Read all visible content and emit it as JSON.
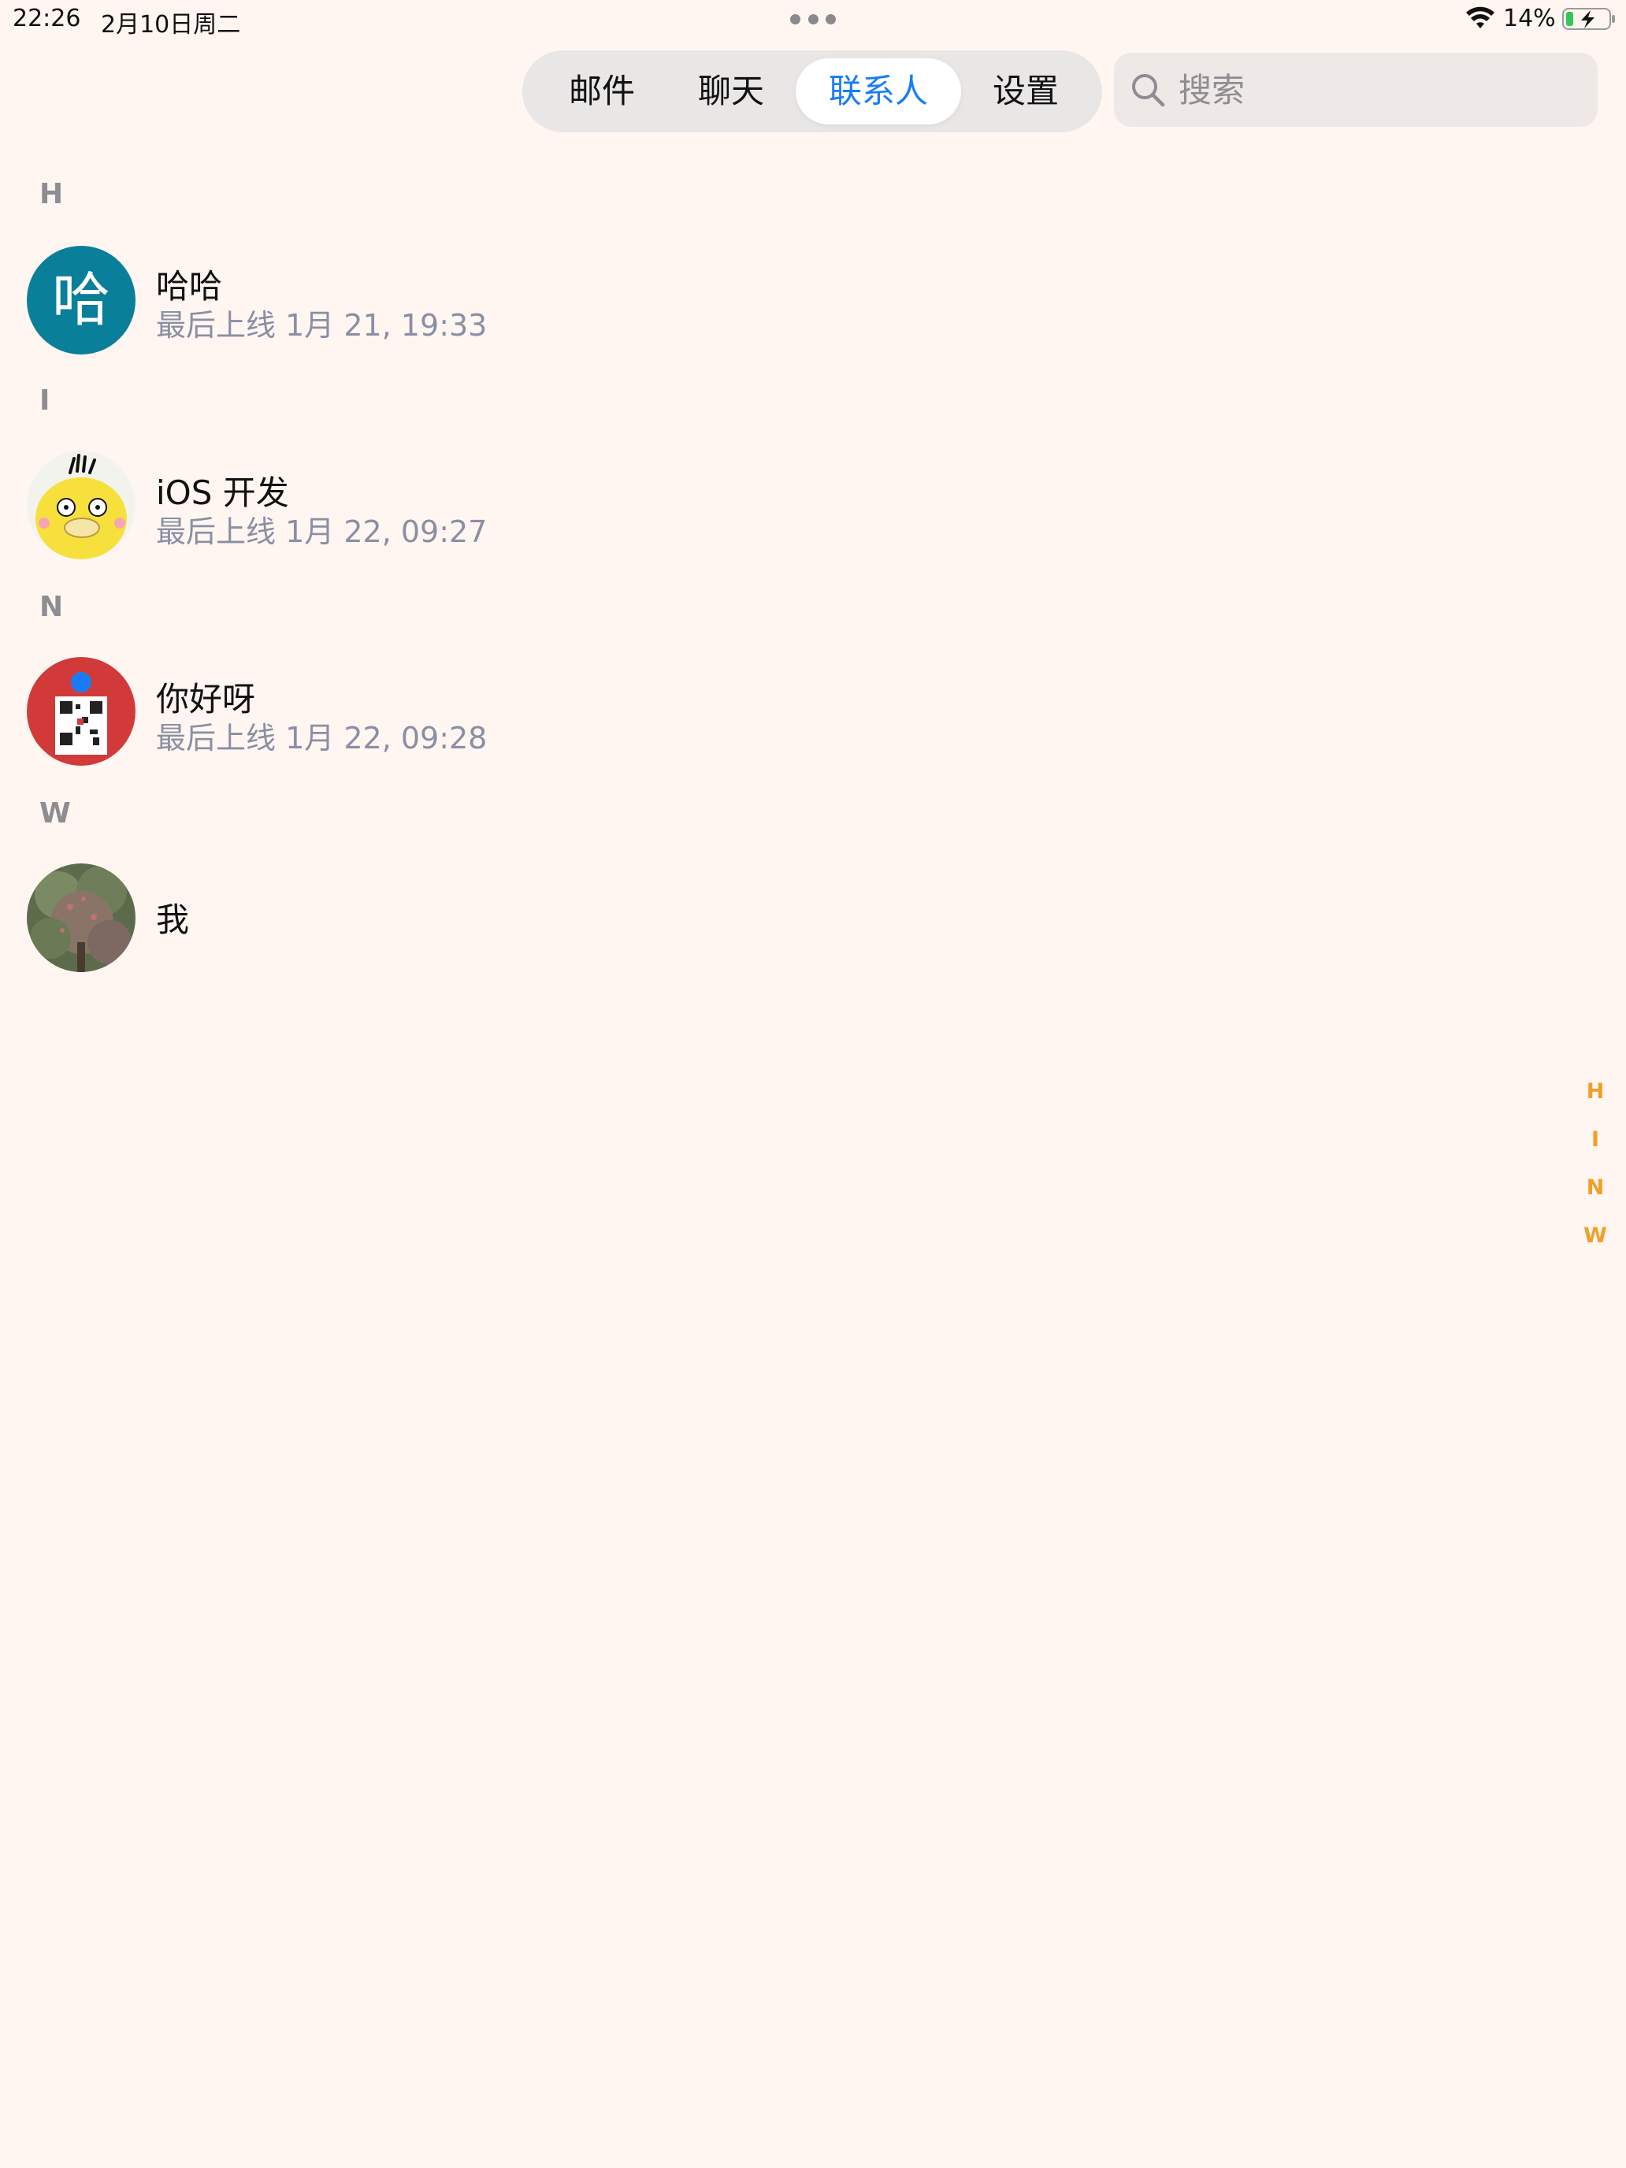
{
  "status_bar": {
    "time": "22:26",
    "date": "2月10日周二",
    "battery": "14%"
  },
  "tabs": [
    {
      "label": "邮件"
    },
    {
      "label": "聊天"
    },
    {
      "label": "联系人",
      "active": true
    },
    {
      "label": "设置"
    }
  ],
  "search": {
    "placeholder": "搜索",
    "value": ""
  },
  "sections": [
    {
      "letter": "H",
      "contacts": [
        {
          "name": "哈哈",
          "status": "最后上线 1月 21, 19:33",
          "avatar_text": "哈"
        }
      ]
    },
    {
      "letter": "I",
      "contacts": [
        {
          "name": "iOS 开发",
          "status": "最后上线 1月 22, 09:27"
        }
      ]
    },
    {
      "letter": "N",
      "contacts": [
        {
          "name": "你好呀",
          "status": "最后上线 1月 22, 09:28"
        }
      ]
    },
    {
      "letter": "W",
      "contacts": [
        {
          "name": "我",
          "status": ""
        }
      ]
    }
  ],
  "index": [
    "H",
    "I",
    "N",
    "W"
  ],
  "colors": {
    "accent": "#1a7cf5",
    "index_color": "#f0a028",
    "background": "#fff6f2",
    "avatar_teal": "#0a7f9a"
  }
}
